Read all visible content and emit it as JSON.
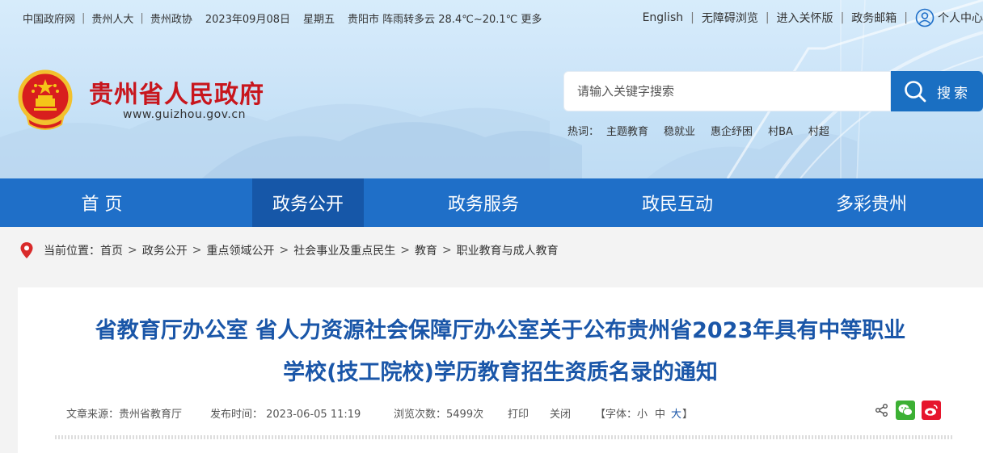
{
  "topbar": {
    "left_links": [
      "中国政府网",
      "贵州人大",
      "贵州政协"
    ],
    "date": "2023年09月08日",
    "weekday": "星期五",
    "weather": "贵阳市 阵雨转多云 28.4℃~20.1℃ 更多",
    "right_links": [
      "English",
      "无障碍浏览",
      "进入关怀版",
      "政务邮箱"
    ],
    "personal_center": "个人中心"
  },
  "site": {
    "title": "贵州省人民政府",
    "url": "www.guizhou.gov.cn"
  },
  "search": {
    "placeholder": "请输入关键字搜索",
    "button_label": "搜索",
    "hot_label": "热词：",
    "hot_words": [
      "主题教育",
      "稳就业",
      "惠企纾困",
      "村BA",
      "村超"
    ]
  },
  "nav": {
    "items": [
      "首 页",
      "政务公开",
      "政务服务",
      "政民互动",
      "多彩贵州"
    ],
    "active_index": 1
  },
  "breadcrumb": {
    "prefix": "当前位置：",
    "items": [
      "首页",
      "政务公开",
      "重点领域公开",
      "社会事业及重点民生",
      "教育",
      "职业教育与成人教育"
    ],
    "separator": ">"
  },
  "article": {
    "title_line1": "省教育厅办公室 省人力资源社会保障厅办公室关于公布贵州省2023年具有中等职业",
    "title_line2": "学校(技工院校)学历教育招生资质名录的通知",
    "source": "文章来源：贵州省教育厅",
    "published": "发布时间： 2023-06-05 11:19",
    "views": "浏览次数：5499次",
    "print_label": "打印",
    "close_label": "关闭",
    "font_label": "【字体：",
    "font_small": "小",
    "font_medium": "中",
    "font_large": "大",
    "font_close": "】"
  },
  "colors": {
    "title_red": "#c8161d",
    "nav_blue": "#1f6fc8",
    "nav_active": "#1657a8",
    "article_title": "#1a56a8",
    "wechat_green": "#3cb034",
    "weibo_red": "#e6162d"
  }
}
